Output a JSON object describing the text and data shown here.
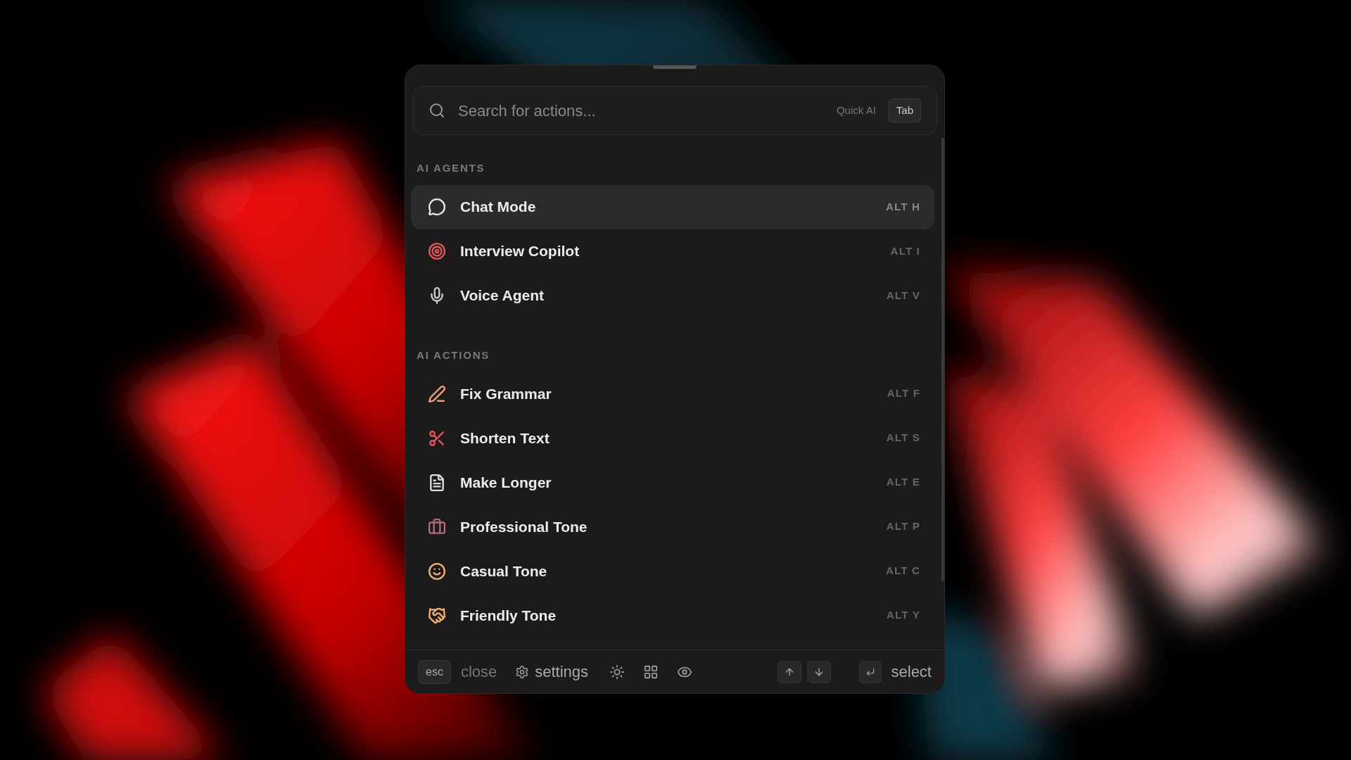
{
  "search": {
    "placeholder": "Search for actions...",
    "hint": "Quick AI",
    "hint_key": "Tab"
  },
  "sections": [
    {
      "title": "AI AGENTS",
      "items": [
        {
          "label": "Chat Mode",
          "kind": "chat",
          "shortcut": "ALT H",
          "selected": true
        },
        {
          "label": "Interview Copilot",
          "kind": "target",
          "shortcut": "ALT I",
          "selected": false
        },
        {
          "label": "Voice Agent",
          "kind": "mic",
          "shortcut": "ALT V",
          "selected": false
        }
      ]
    },
    {
      "title": "AI ACTIONS",
      "items": [
        {
          "label": "Fix Grammar",
          "kind": "pen",
          "shortcut": "ALT F",
          "selected": false
        },
        {
          "label": "Shorten Text",
          "kind": "scissors",
          "shortcut": "ALT S",
          "selected": false
        },
        {
          "label": "Make Longer",
          "kind": "document",
          "shortcut": "ALT E",
          "selected": false
        },
        {
          "label": "Professional Tone",
          "kind": "briefcase",
          "shortcut": "ALT P",
          "selected": false
        },
        {
          "label": "Casual Tone",
          "kind": "smile",
          "shortcut": "ALT C",
          "selected": false
        },
        {
          "label": "Friendly Tone",
          "kind": "handshake",
          "shortcut": "ALT Y",
          "selected": false
        }
      ]
    }
  ],
  "footer": {
    "esc_key": "esc",
    "close": "close",
    "settings": "settings",
    "select": "select"
  }
}
